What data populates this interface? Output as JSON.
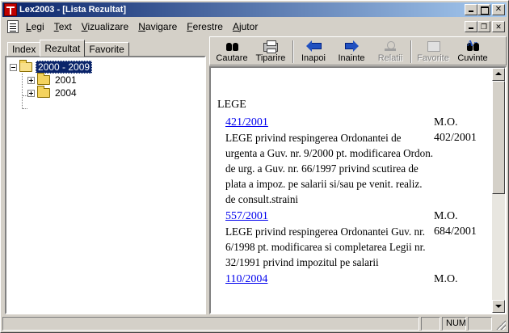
{
  "window": {
    "title": "Lex2003 - [Lista Rezultat]"
  },
  "menu": {
    "items": [
      "Legi",
      "Text",
      "Vizualizare",
      "Navigare",
      "Ferestre",
      "Ajutor"
    ]
  },
  "tabs": [
    "Index",
    "Rezultat",
    "Favorite"
  ],
  "active_tab": "Rezultat",
  "tree": {
    "root": "2000 - 2009",
    "children": [
      "2001",
      "2004"
    ]
  },
  "toolbar": {
    "search": "Cautare",
    "print": "Tiparire",
    "back": "Inapoi",
    "forward": "Inainte",
    "relations": "Relatii",
    "favorites": "Favorite",
    "words": "Cuvinte",
    "words_glyph": "Aa"
  },
  "document": {
    "section": "LEGE",
    "entries": [
      {
        "link": "421/2001",
        "desc": "LEGE privind respingerea Ordonantei de urgenta a Guv. nr. 9/2000 pt. modificarea Ordon. de urg. a Guv. nr. 66/1997 privind scutirea de plata a impoz. pe salarii si/sau pe venit. realiz. de consult.straini",
        "src_1": "M.O.",
        "src_2": "402/2001"
      },
      {
        "link": "557/2001",
        "desc": "LEGE privind respingerea Ordonantei Guv. nr. 6/1998 pt. modificarea si completarea Legii nr. 32/1991 privind impozitul pe salarii",
        "src_1": "M.O.",
        "src_2": "684/2001"
      },
      {
        "link": "110/2004",
        "desc": "",
        "src_1": "M.O.",
        "src_2": ""
      }
    ]
  },
  "status": {
    "num": "NUM"
  }
}
